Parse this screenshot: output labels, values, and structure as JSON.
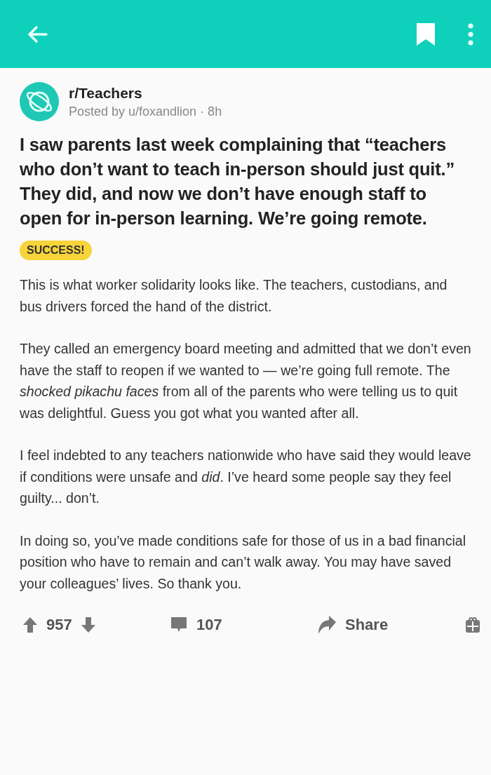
{
  "post": {
    "subreddit": "r/Teachers",
    "meta": "Posted by u/foxandlion · 8h",
    "title": "I saw parents last week complaining that “teachers who don’t want to teach in-person should just quit.” They did, and now we don’t have enough staff to open for in-person learning. We’re going remote.",
    "flair": "SUCCESS!",
    "paragraphs": [
      "This is what worker solidarity looks like. The teachers, custodians, and bus drivers forced the hand of the district.",
      "They called an emergency board meeting and admitted that we don’t even have the staff to reopen if we wanted to — we’re going full remote. The *shocked pikachu faces* from all of the parents who were telling us to quit was delightful. Guess you got what you wanted after all.",
      "I feel indebted to any teachers nationwide who have said they would leave if conditions were unsafe and *did*. I’ve heard some people say they feel guilty... don’t.",
      "In doing so, you’ve made conditions safe for those of us in a bad financial position who have to remain and can’t walk away. You may have saved your colleagues’ lives. So thank you."
    ]
  },
  "actions": {
    "votes": "957",
    "comments": "107",
    "share": "Share"
  }
}
